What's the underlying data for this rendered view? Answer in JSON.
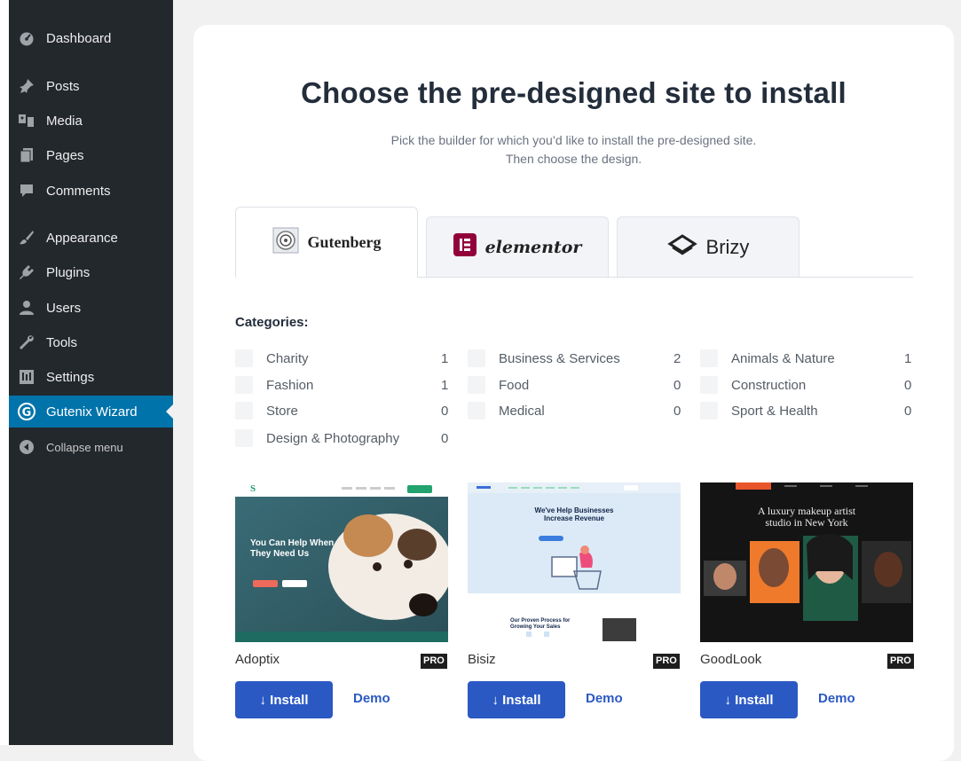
{
  "sidebar": {
    "items": [
      {
        "label": "Dashboard",
        "icon": "dashboard-icon"
      },
      {
        "label": "Posts",
        "icon": "pin-icon"
      },
      {
        "label": "Media",
        "icon": "media-icon"
      },
      {
        "label": "Pages",
        "icon": "pages-icon"
      },
      {
        "label": "Comments",
        "icon": "comment-icon"
      },
      {
        "label": "Appearance",
        "icon": "brush-icon"
      },
      {
        "label": "Plugins",
        "icon": "plugin-icon"
      },
      {
        "label": "Users",
        "icon": "users-icon"
      },
      {
        "label": "Tools",
        "icon": "wrench-icon"
      },
      {
        "label": "Settings",
        "icon": "settings-icon"
      },
      {
        "label": "Gutenix Wizard",
        "icon": "gutenix-g-icon",
        "active": true
      },
      {
        "label": "Collapse menu",
        "icon": "collapse-icon"
      }
    ]
  },
  "page": {
    "title": "Choose the pre-designed site to install",
    "subtitle_line1": "Pick the builder for which you’d like to install the pre-designed site.",
    "subtitle_line2": "Then choose the design."
  },
  "tabs": [
    {
      "label": "Gutenberg",
      "active": true
    },
    {
      "label": "elementor",
      "active": false
    },
    {
      "label": "Brizy",
      "active": false
    }
  ],
  "categories": {
    "heading": "Categories:",
    "items": [
      {
        "label": "Charity",
        "count": "1"
      },
      {
        "label": "Business & Services",
        "count": "2"
      },
      {
        "label": "Animals & Nature",
        "count": "1"
      },
      {
        "label": "Fashion",
        "count": "1"
      },
      {
        "label": "Food",
        "count": "0"
      },
      {
        "label": "Construction",
        "count": "0"
      },
      {
        "label": "Store",
        "count": "0"
      },
      {
        "label": "Medical",
        "count": "0"
      },
      {
        "label": "Sport & Health",
        "count": "0"
      },
      {
        "label": "Design & Photography",
        "count": "0"
      }
    ]
  },
  "templates": [
    {
      "name": "Adoptix",
      "badge": "PRO",
      "install": "↓ Install",
      "demo": "Demo",
      "preview_logo": "S",
      "preview_headline": "You Can Help When They Need Us"
    },
    {
      "name": "Bisiz",
      "badge": "PRO",
      "install": "↓ Install",
      "demo": "Demo",
      "preview_headline": "We've Help Businesses Increase Revenue",
      "preview_sub": "Our Proven Process for Growing Your Sales"
    },
    {
      "name": "GoodLook",
      "badge": "PRO",
      "install": "↓ Install",
      "demo": "Demo",
      "preview_headline": "A luxury makeup artist studio in New York"
    }
  ],
  "colors": {
    "sidebar_bg": "#23282d",
    "active_menu": "#0073aa",
    "primary_button": "#2b59c3",
    "title": "#232d3b"
  }
}
